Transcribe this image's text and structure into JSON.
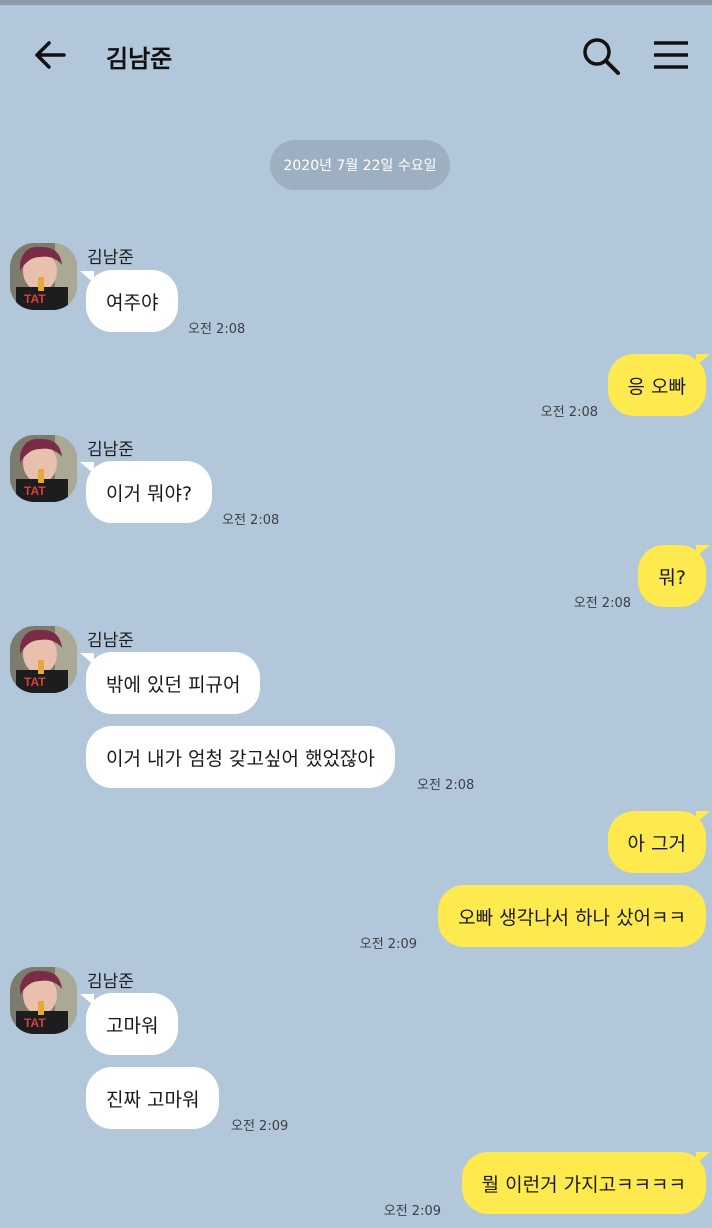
{
  "header": {
    "title": "김남준",
    "back_icon": "arrow-left-icon",
    "search_icon": "search-icon",
    "menu_icon": "hamburger-menu-icon"
  },
  "date_divider": "2020년 7월 22일 수요일",
  "colors": {
    "background": "#b2c7da",
    "incoming_bubble": "#ffffff",
    "outgoing_bubble": "#fee94e"
  },
  "messages": [
    {
      "sender": "김남준",
      "direction": "in",
      "text": "여주야",
      "time": "오전 2:08"
    },
    {
      "direction": "out",
      "text": "응 오빠",
      "time": "오전 2:08"
    },
    {
      "sender": "김남준",
      "direction": "in",
      "text": "이거 뭐야?",
      "time": "오전 2:08"
    },
    {
      "direction": "out",
      "text": "뭐?",
      "time": "오전 2:08"
    },
    {
      "sender": "김남준",
      "direction": "in",
      "text": "밖에 있던 피규어"
    },
    {
      "direction": "in",
      "text": "이거 내가 엄청 갖고싶어 했었잖아",
      "time": "오전 2:08"
    },
    {
      "direction": "out",
      "text": "아 그거"
    },
    {
      "direction": "out",
      "text": "오빠 생각나서 하나 샀어ㅋㅋ",
      "time": "오전 2:09"
    },
    {
      "sender": "김남준",
      "direction": "in",
      "text": "고마워"
    },
    {
      "direction": "in",
      "text": "진짜 고마워",
      "time": "오전 2:09"
    },
    {
      "direction": "out",
      "text": "뭘 이런거 가지고ㅋㅋㅋㅋ",
      "time": "오전 2:09"
    }
  ]
}
